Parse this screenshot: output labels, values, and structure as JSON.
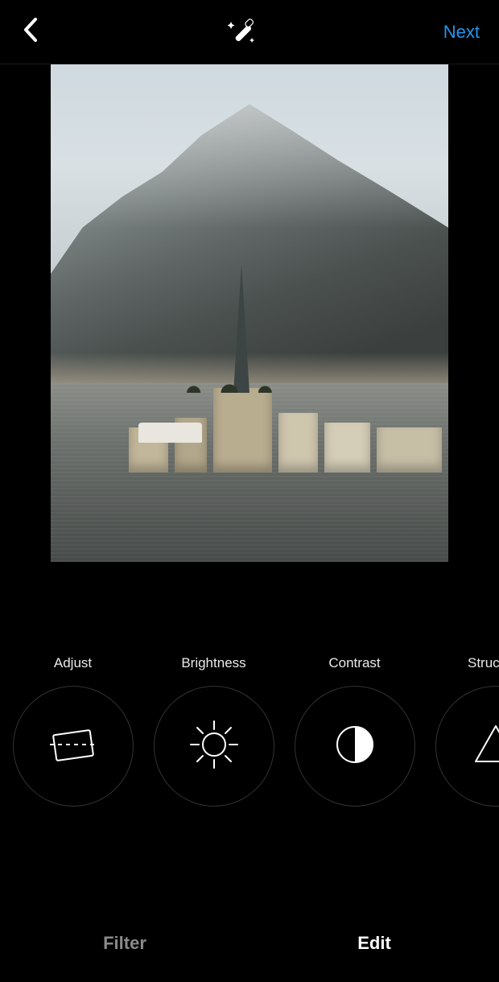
{
  "header": {
    "next_label": "Next"
  },
  "tools": [
    {
      "id": "adjust",
      "label": "Adjust"
    },
    {
      "id": "brightness",
      "label": "Brightness"
    },
    {
      "id": "contrast",
      "label": "Contrast"
    },
    {
      "id": "structure",
      "label": "Structure"
    }
  ],
  "tabs": {
    "filter_label": "Filter",
    "edit_label": "Edit",
    "active": "edit"
  },
  "colors": {
    "accent": "#2196f3",
    "background": "#000000"
  }
}
